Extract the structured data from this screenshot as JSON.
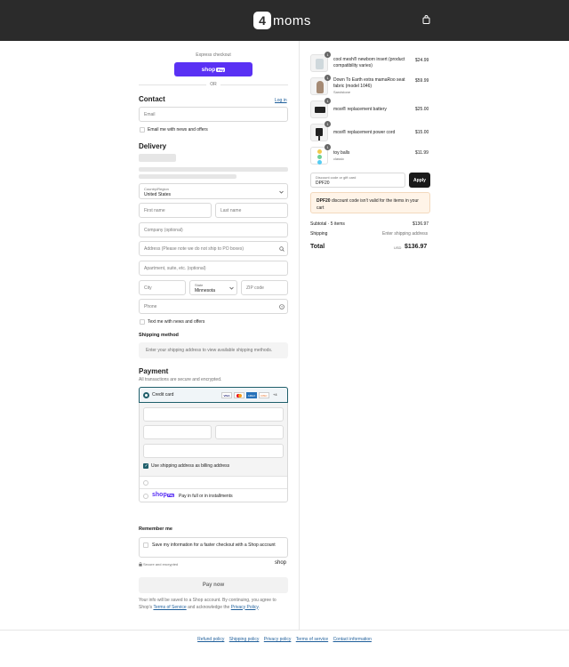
{
  "header": {
    "brand_badge": "4",
    "brand_word": "moms"
  },
  "express": {
    "label": "Express checkout",
    "shop_pay": "shop",
    "shop_pay_badge": "Pay",
    "or": "OR"
  },
  "contact": {
    "title": "Contact",
    "login": "Log in",
    "email_placeholder": "Email",
    "news_label": "Email me with news and offers"
  },
  "delivery": {
    "title": "Delivery",
    "country_label": "Country/Region",
    "country_value": "United States",
    "first_name": "First name",
    "last_name": "Last name",
    "company": "Company (optional)",
    "address": "Address (Please note we do not ship to PO boxes)",
    "apartment": "Apartment, suite, etc. (optional)",
    "city": "City",
    "state_label": "State",
    "state_value": "Minnesota",
    "zip": "ZIP code",
    "phone": "Phone",
    "text_label": "Text me with news and offers"
  },
  "shipping": {
    "title": "Shipping method",
    "note": "Enter your shipping address to view available shipping methods."
  },
  "payment": {
    "title": "Payment",
    "subtitle": "All transactions are secure and encrypted.",
    "credit_card": "Credit card",
    "more_cards": "+4",
    "card_brands": [
      "VISA",
      "MC",
      "AMEX",
      "DISC"
    ],
    "billing_label": "Use shipping address as billing address",
    "shop_pay_label": "Pay in full or in installments"
  },
  "remember": {
    "title": "Remember me",
    "save_label": "Save my information for a faster checkout with a Shop account",
    "secure": "Secure and encrypted",
    "shop": "shop"
  },
  "pay_now": "Pay now",
  "legal": {
    "text1": "Your info will be saved to a Shop account. By continuing, you agree to Shop's",
    "tos": "Terms of Service",
    "and": "and acknowledge the",
    "privacy": "Privacy Policy",
    "end": "."
  },
  "cart": {
    "items": [
      {
        "qty": "1",
        "name": "cool mesh® newborn insert (product compatibility varies)",
        "variant": "",
        "price": "$24.99"
      },
      {
        "qty": "1",
        "name": "Down To Earth extra mamaRoo seat fabric (model 1046)",
        "variant": "Sandstone",
        "price": "$59.99"
      },
      {
        "qty": "1",
        "name": "moxi® replacement battery",
        "variant": "",
        "price": "$25.00"
      },
      {
        "qty": "1",
        "name": "moxi® replacement power cord",
        "variant": "",
        "price": "$15.00"
      },
      {
        "qty": "1",
        "name": "toy balls",
        "variant": "classic",
        "price": "$11.99"
      }
    ],
    "discount_label": "Discount code or gift card",
    "discount_value": "DPF20",
    "apply": "Apply",
    "discount_error_code": "DPF20",
    "discount_error": "discount code isn't valid for the items in your cart",
    "subtotal_label": "Subtotal · 5 items",
    "subtotal": "$136.97",
    "shipping_label": "Shipping",
    "shipping_value": "Enter shipping address",
    "total_label": "Total",
    "currency": "USD",
    "total": "$136.97"
  },
  "footer": [
    "Refund policy",
    "Shipping policy",
    "Privacy policy",
    "Terms of service",
    "Contact information"
  ],
  "colors": {
    "header": "#2b2b2b",
    "shop_pay": "#5a31f4",
    "accent": "#1f5f6b",
    "link": "#1f5f9b",
    "error_bg": "#fff4e8"
  }
}
